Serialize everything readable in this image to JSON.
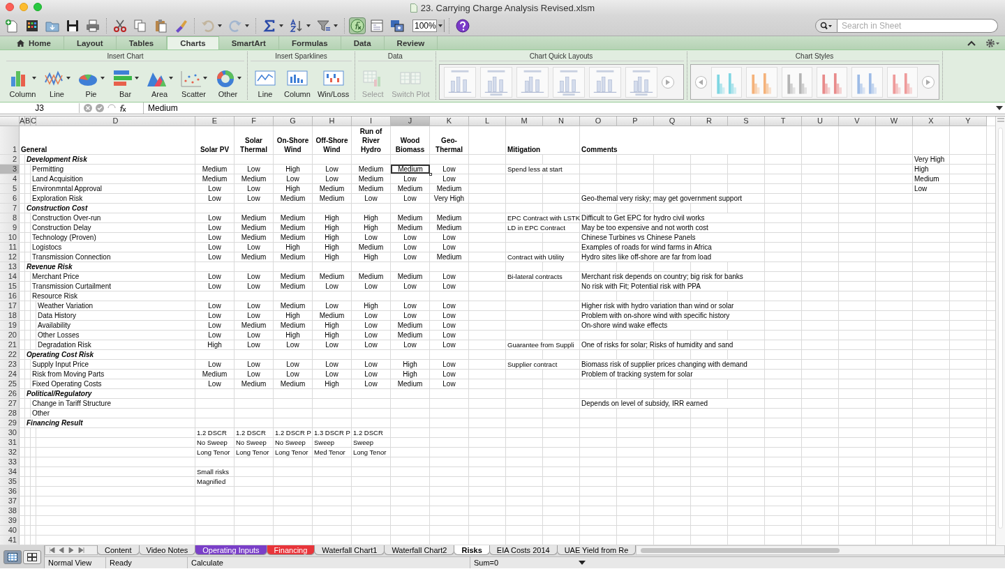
{
  "window": {
    "title": "23. Carrying Charge Analysis Revised.xlsm"
  },
  "toolbar": {
    "undo": {
      "disabled": true
    },
    "redo": {
      "disabled": true
    },
    "formula_builder": {
      "pressed": true
    },
    "zoom": "100%"
  },
  "search": {
    "placeholder": "Search in Sheet"
  },
  "ribbon_tabs": [
    {
      "label": "Home",
      "selected": false
    },
    {
      "label": "Layout",
      "selected": false
    },
    {
      "label": "Tables",
      "selected": false
    },
    {
      "label": "Charts",
      "selected": true
    },
    {
      "label": "SmartArt",
      "selected": false
    },
    {
      "label": "Formulas",
      "selected": false
    },
    {
      "label": "Data",
      "selected": false
    },
    {
      "label": "Review",
      "selected": false
    }
  ],
  "ribbon_groups": [
    {
      "title": "Insert Chart",
      "buttons": [
        {
          "label": "Column",
          "kind": "column",
          "menu": true,
          "disabled": false
        },
        {
          "label": "Line",
          "kind": "line",
          "menu": true,
          "disabled": false
        },
        {
          "label": "Pie",
          "kind": "pie",
          "menu": true,
          "disabled": false
        },
        {
          "label": "Bar",
          "kind": "bar",
          "menu": true,
          "disabled": false
        },
        {
          "label": "Area",
          "kind": "area",
          "menu": true,
          "disabled": false
        },
        {
          "label": "Scatter",
          "kind": "scatter",
          "menu": true,
          "disabled": false
        },
        {
          "label": "Other",
          "kind": "other",
          "menu": true,
          "disabled": false
        }
      ]
    },
    {
      "title": "Insert Sparklines",
      "buttons": [
        {
          "label": "Line",
          "kind": "spark-line",
          "menu": false,
          "disabled": false
        },
        {
          "label": "Column",
          "kind": "spark-column",
          "menu": false,
          "disabled": false
        },
        {
          "label": "Win/Loss",
          "kind": "spark-winloss",
          "menu": false,
          "disabled": false
        }
      ]
    },
    {
      "title": "Data",
      "buttons": [
        {
          "label": "Select",
          "kind": "select",
          "menu": false,
          "disabled": true
        },
        {
          "label": "Switch Plot",
          "kind": "switch",
          "menu": false,
          "disabled": true
        }
      ]
    }
  ],
  "chart_quick_layouts": {
    "title": "Chart Quick Layouts"
  },
  "chart_styles": {
    "title": "Chart Styles",
    "items": [
      {
        "color": "#7fd6e2"
      },
      {
        "color": "#f4b27a"
      },
      {
        "color": "#b4b4b4"
      },
      {
        "color": "#e88a8a"
      },
      {
        "color": "#9dbbe6"
      },
      {
        "color": "#ee9a9a"
      }
    ]
  },
  "formula_bar": {
    "cell": "J3",
    "value": "Medium"
  },
  "columns": [
    {
      "label": "A",
      "selected": false
    },
    {
      "label": "B",
      "selected": false
    },
    {
      "label": "C",
      "selected": false
    },
    {
      "label": "D",
      "selected": false
    },
    {
      "label": "E",
      "selected": false
    },
    {
      "label": "F",
      "selected": false
    },
    {
      "label": "G",
      "selected": false
    },
    {
      "label": "H",
      "selected": false
    },
    {
      "label": "I",
      "selected": false
    },
    {
      "label": "J",
      "selected": true
    },
    {
      "label": "K",
      "selected": false
    },
    {
      "label": "L",
      "selected": false
    },
    {
      "label": "M",
      "selected": false
    },
    {
      "label": "N",
      "selected": false
    },
    {
      "label": "O",
      "selected": false
    },
    {
      "label": "P",
      "selected": false
    },
    {
      "label": "Q",
      "selected": false
    },
    {
      "label": "R",
      "selected": false
    },
    {
      "label": "S",
      "selected": false
    },
    {
      "label": "T",
      "selected": false
    },
    {
      "label": "U",
      "selected": false
    },
    {
      "label": "V",
      "selected": false
    },
    {
      "label": "W",
      "selected": false
    },
    {
      "label": "X",
      "selected": false
    },
    {
      "label": "Y",
      "selected": false
    }
  ],
  "rows": [
    {
      "n": "1",
      "kind": "header",
      "selected": false,
      "label": "General",
      "values": [
        "Solar PV",
        "Solar\nThermal",
        "On-Shore\nWind",
        "Off-Shore\nWind",
        "Run of\nRiver\nHydro",
        "Wood\nBiomass",
        "Geo-\nThermal"
      ],
      "mitigation": "Mitigation",
      "comment": "Comments"
    },
    {
      "n": "2",
      "kind": "section",
      "selected": false,
      "label": "Development Risk",
      "x": "Very High"
    },
    {
      "n": "3",
      "kind": "item",
      "selected": true,
      "label": "Permitting",
      "values": [
        "Medium",
        "Low",
        "High",
        "Low",
        "Medium",
        "Medium",
        "Low"
      ],
      "mitigation": "Spend less at start",
      "x": "High"
    },
    {
      "n": "4",
      "kind": "item",
      "selected": false,
      "label": "Land Acquisition",
      "values": [
        "Medium",
        "Medium",
        "Low",
        "Low",
        "Medium",
        "Low",
        "Low"
      ],
      "x": "Medium"
    },
    {
      "n": "5",
      "kind": "item",
      "selected": false,
      "label": "Environmntal Approval",
      "values": [
        "Low",
        "Low",
        "High",
        "Medium",
        "Medium",
        "Medium",
        "Medium"
      ],
      "x": "Low"
    },
    {
      "n": "6",
      "kind": "item",
      "selected": false,
      "label": "Exploration Risk",
      "values": [
        "Low",
        "Low",
        "Medium",
        "Medium",
        "Low",
        "Low",
        "Very High"
      ],
      "comment": "Geo-themal very risky; may get government support"
    },
    {
      "n": "7",
      "kind": "section",
      "selected": false,
      "label": "Construction Cost"
    },
    {
      "n": "8",
      "kind": "item",
      "selected": false,
      "label": "Construction Over-run",
      "values": [
        "Low",
        "Medium",
        "Medium",
        "High",
        "High",
        "Medium",
        "Medium"
      ],
      "mitigation": "EPC Contract with LSTK",
      "comment": "Difficult to Get EPC for hydro civil works"
    },
    {
      "n": "9",
      "kind": "item",
      "selected": false,
      "label": "Construction Delay",
      "values": [
        "Low",
        "Medium",
        "Medium",
        "High",
        "High",
        "Medium",
        "Medium"
      ],
      "mitigation": "LD in EPC Contract",
      "comment": "May be too expensive and not worth cost"
    },
    {
      "n": "10",
      "kind": "item",
      "selected": false,
      "label": "Technology (Proven)",
      "values": [
        "Low",
        "Medium",
        "Medium",
        "High",
        "Low",
        "Low",
        "Low"
      ],
      "comment": "Chinese Turbines vs Chinese Panels"
    },
    {
      "n": "11",
      "kind": "item",
      "selected": false,
      "label": "Logistocs",
      "values": [
        "Low",
        "Low",
        "High",
        "High",
        "Medium",
        "Low",
        "Low"
      ],
      "comment": "Examples of roads for wind farms in Africa"
    },
    {
      "n": "12",
      "kind": "item",
      "selected": false,
      "label": "Transmission Connection",
      "values": [
        "Low",
        "Medium",
        "Medium",
        "High",
        "High",
        "Low",
        "Medium"
      ],
      "mitigation": "Contract with Utility",
      "comment": "Hydro sites like off-shore are far from load"
    },
    {
      "n": "13",
      "kind": "section",
      "selected": false,
      "label": "Revenue Risk"
    },
    {
      "n": "14",
      "kind": "item",
      "selected": false,
      "label": "Merchant Price",
      "values": [
        "Low",
        "Low",
        "Medium",
        "Medium",
        "Medium",
        "Medium",
        "Low"
      ],
      "mitigation": "Bi-lateral contracts",
      "comment": "Merchant risk depends on country; big risk for banks"
    },
    {
      "n": "15",
      "kind": "item",
      "selected": false,
      "label": "Transmission Curtailment",
      "values": [
        "Low",
        "Low",
        "Medium",
        "Low",
        "Low",
        "Low",
        "Low"
      ],
      "comment": "No risk with Fit; Potential risk with PPA"
    },
    {
      "n": "16",
      "kind": "item",
      "selected": false,
      "label": "Resource Risk"
    },
    {
      "n": "17",
      "kind": "subitem",
      "selected": false,
      "label": "Weather Variation",
      "values": [
        "Low",
        "Low",
        "Medium",
        "Low",
        "High",
        "Low",
        "Low"
      ],
      "comment": "Higher risk with hydro variation than wind or solar"
    },
    {
      "n": "18",
      "kind": "subitem",
      "selected": false,
      "label": "Data History",
      "values": [
        "Low",
        "Low",
        "High",
        "Medium",
        "Low",
        "Low",
        "Low"
      ],
      "comment": "Problem with on-shore wind with specific history"
    },
    {
      "n": "19",
      "kind": "subitem",
      "selected": false,
      "label": "Availability",
      "values": [
        "Low",
        "Medium",
        "Medium",
        "High",
        "Low",
        "Medium",
        "Low"
      ],
      "comment": "On-shore wind wake effects"
    },
    {
      "n": "20",
      "kind": "subitem",
      "selected": false,
      "label": "Other Losses",
      "values": [
        "Low",
        "Low",
        "High",
        "High",
        "Low",
        "Medium",
        "Low"
      ]
    },
    {
      "n": "21",
      "kind": "subitem",
      "selected": false,
      "label": "Degradation Risk",
      "values": [
        "High",
        "Low",
        "Low",
        "Low",
        "Low",
        "Low",
        "Low"
      ],
      "mitigation": "Guarantee from Suppli",
      "comment": "One of risks for solar; Risks of humidity and sand"
    },
    {
      "n": "22",
      "kind": "section",
      "selected": false,
      "label": "Operating Cost Risk"
    },
    {
      "n": "23",
      "kind": "item",
      "selected": false,
      "label": "Supply Input Price",
      "values": [
        "Low",
        "Low",
        "Low",
        "Low",
        "Low",
        "High",
        "Low"
      ],
      "mitigation": "Supplier contract",
      "comment": "Biomass risk of supplier prices changing with demand"
    },
    {
      "n": "24",
      "kind": "item",
      "selected": false,
      "label": "Risk from Moving Parts",
      "values": [
        "Medium",
        "Low",
        "Low",
        "Low",
        "Low",
        "High",
        "Low"
      ],
      "comment": "Problem of tracking system for solar"
    },
    {
      "n": "25",
      "kind": "item",
      "selected": false,
      "label": "Fixed Operating Costs",
      "values": [
        "Low",
        "Medium",
        "Medium",
        "High",
        "Low",
        "Medium",
        "Low"
      ]
    },
    {
      "n": "26",
      "kind": "section",
      "selected": false,
      "label": "Political/Regulatory"
    },
    {
      "n": "27",
      "kind": "item",
      "selected": false,
      "label": "Change in Tariff Structure",
      "comment": "Depends on level of subsidy, IRR earned"
    },
    {
      "n": "28",
      "kind": "item",
      "selected": false,
      "label": "Other"
    },
    {
      "n": "29",
      "kind": "section",
      "selected": false,
      "label": "Financing Result"
    },
    {
      "n": "30",
      "kind": "note",
      "selected": false,
      "values": [
        "1.2 DSCR",
        "1.2 DSCR",
        "1.2 DSCR P",
        "1.3 DSCR P",
        "1.2 DSCR"
      ]
    },
    {
      "n": "31",
      "kind": "note",
      "selected": false,
      "values": [
        "No Sweep",
        "No Sweep",
        "No Sweep",
        "Sweep",
        "Sweep"
      ]
    },
    {
      "n": "32",
      "kind": "note",
      "selected": false,
      "values": [
        "Long Tenor",
        "Long Tenor",
        "Long Tenor",
        "Med Tenor",
        "Long Tenor"
      ]
    },
    {
      "n": "33",
      "kind": "blank",
      "selected": false
    },
    {
      "n": "34",
      "kind": "note",
      "selected": false,
      "values": [
        "Small risks"
      ]
    },
    {
      "n": "35",
      "kind": "note",
      "selected": false,
      "values": [
        "Magnified"
      ]
    },
    {
      "n": "36",
      "kind": "blank",
      "selected": false
    },
    {
      "n": "37",
      "kind": "blank",
      "selected": false
    },
    {
      "n": "38",
      "kind": "blank",
      "selected": false
    },
    {
      "n": "39",
      "kind": "blank",
      "selected": false
    },
    {
      "n": "40",
      "kind": "blank",
      "selected": false
    },
    {
      "n": "41",
      "kind": "blank",
      "selected": false
    }
  ],
  "sheet_tabs": [
    {
      "label": "Content",
      "selected": false
    },
    {
      "label": "Video Notes",
      "selected": false
    },
    {
      "label": "Operating Inputs",
      "selected": false,
      "color": "#7a3fc8"
    },
    {
      "label": "Financing",
      "selected": false,
      "color": "#e8343a"
    },
    {
      "label": "Waterfall Chart1",
      "selected": false
    },
    {
      "label": "Waterfall Chart2",
      "selected": false
    },
    {
      "label": "Risks",
      "selected": true
    },
    {
      "label": "EIA Costs 2014",
      "selected": false
    },
    {
      "label": "UAE Yield from Re",
      "selected": false
    }
  ],
  "status_bar": {
    "view": "Normal View",
    "state": "Ready",
    "mode": "Calculate",
    "sum": "Sum=0"
  }
}
